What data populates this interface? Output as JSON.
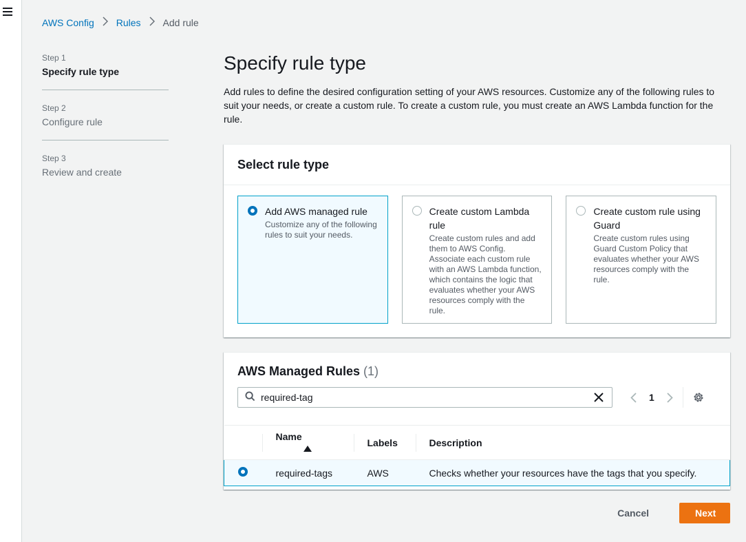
{
  "breadcrumb": {
    "items": [
      "AWS Config",
      "Rules"
    ],
    "current": "Add rule"
  },
  "steps": [
    {
      "num": "Step 1",
      "title": "Specify rule type",
      "active": true
    },
    {
      "num": "Step 2",
      "title": "Configure rule",
      "active": false
    },
    {
      "num": "Step 3",
      "title": "Review and create",
      "active": false
    }
  ],
  "page": {
    "title": "Specify rule type",
    "description": "Add rules to define the desired configuration setting of your AWS resources. Customize any of the following rules to suit your needs, or create a custom rule. To create a custom rule, you must create an AWS Lambda function for the rule."
  },
  "rule_type": {
    "header": "Select rule type",
    "options": [
      {
        "title": "Add AWS managed rule",
        "desc": "Customize any of the following rules to suit your needs.",
        "selected": true
      },
      {
        "title": "Create custom Lambda rule",
        "desc": "Create custom rules and add them to AWS Config. Associate each custom rule with an AWS Lambda function, which contains the logic that evaluates whether your AWS resources comply with the rule.",
        "selected": false
      },
      {
        "title": "Create custom rule using Guard",
        "desc": "Create custom rules using Guard Custom Policy that evaluates whether your AWS resources comply with the rule.",
        "selected": false
      }
    ]
  },
  "managed_rules": {
    "header": "AWS Managed Rules",
    "count": "(1)",
    "search_value": "required-tag",
    "page_number": "1",
    "columns": [
      "Name",
      "Labels",
      "Description"
    ],
    "rows": [
      {
        "name": "required-tags",
        "labels": "AWS",
        "description": "Checks whether your resources have the tags that you specify.",
        "selected": true
      }
    ]
  },
  "actions": {
    "cancel": "Cancel",
    "next": "Next"
  },
  "colors": {
    "link": "#0073bb",
    "primary": "#ec7211",
    "selected_bg": "#f1faff",
    "selected_border": "#00a1c9"
  }
}
